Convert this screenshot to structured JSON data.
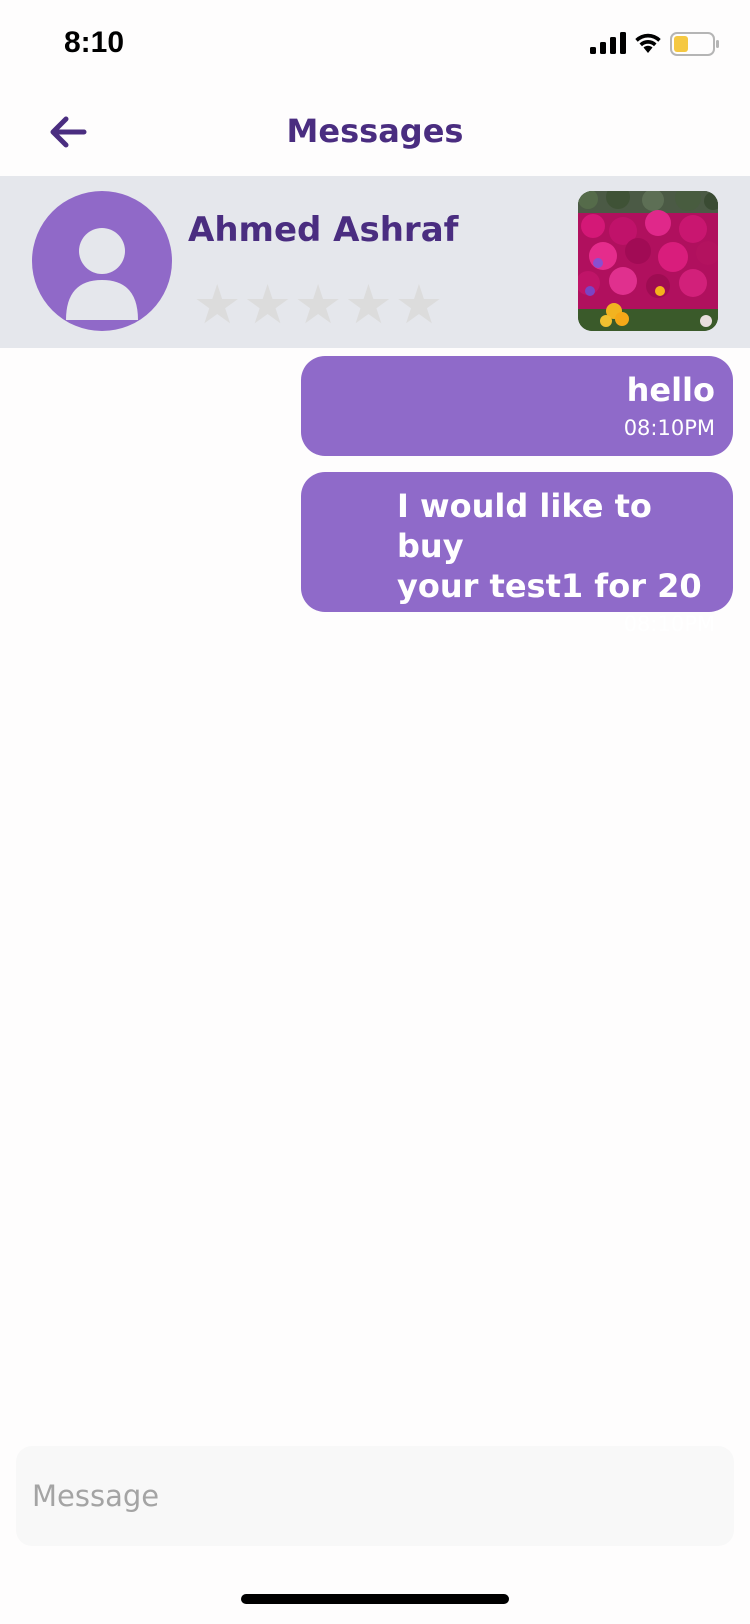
{
  "status_bar": {
    "time": "8:10",
    "icons": [
      "signal-icon",
      "wifi-icon",
      "battery-icon"
    ],
    "battery_color": "#f5c842"
  },
  "header": {
    "title": "Messages",
    "back_icon": "arrow-left-icon"
  },
  "contact": {
    "name": "Ahmed Ashraf",
    "rating_stars": 0,
    "rating_max": 5,
    "avatar_icon": "user-icon",
    "product_image": "flowers-photo"
  },
  "messages": [
    {
      "text": "hello",
      "time": "08:10PM",
      "sender": "me"
    },
    {
      "text": "I would like to buy\nyour test1 for 20",
      "time": "08:10PM",
      "sender": "me"
    }
  ],
  "composer": {
    "placeholder": "Message"
  },
  "colors": {
    "accent": "#8f6ac9",
    "title": "#4a2d80",
    "card_bg": "#e5e7ec"
  }
}
